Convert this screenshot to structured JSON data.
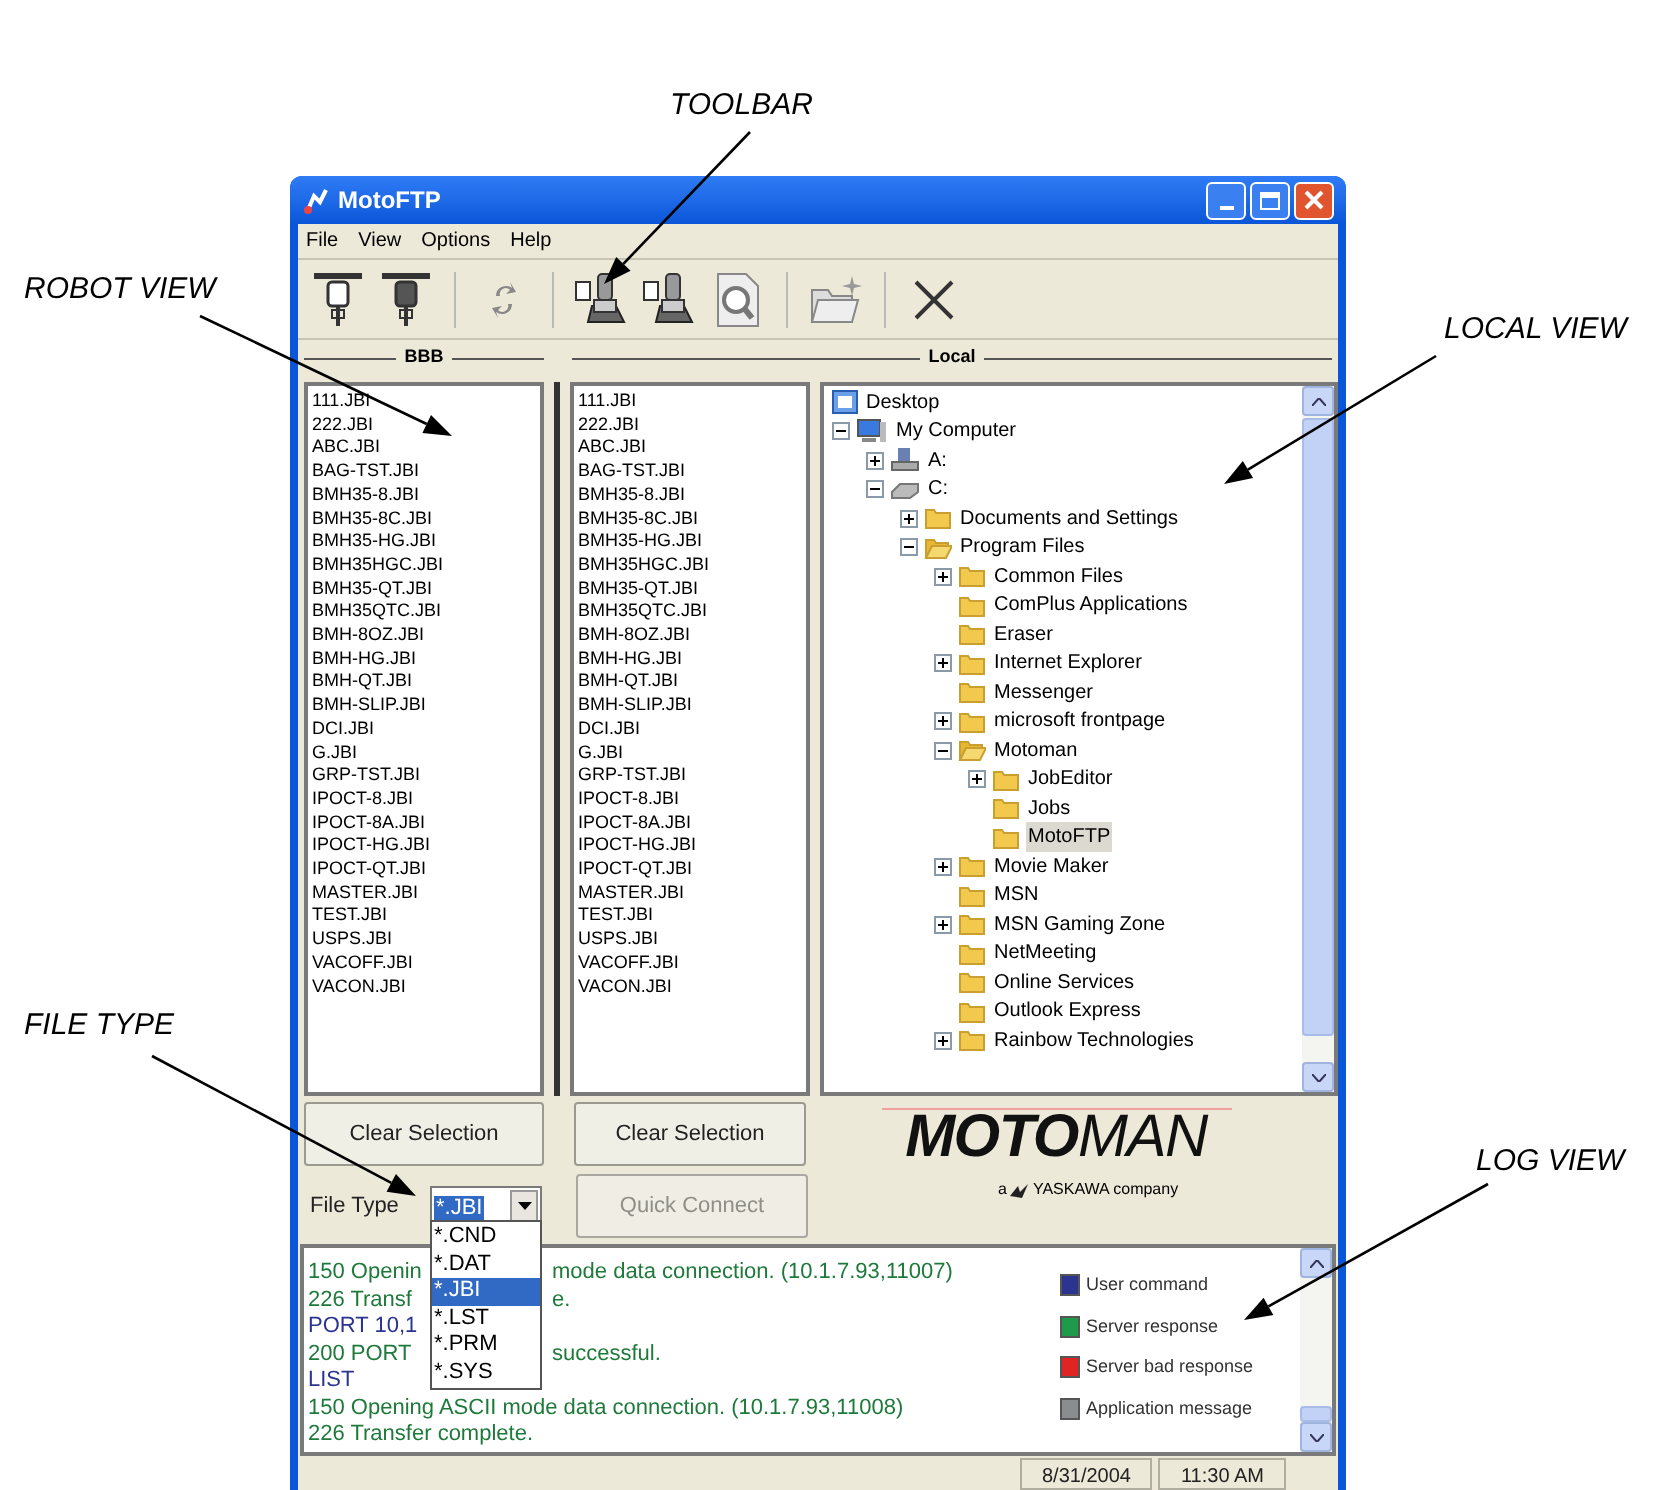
{
  "annotations": [
    "TOOLBAR",
    "ROBOT VIEW",
    "LOCAL VIEW",
    "FILE TYPE",
    "LOG VIEW"
  ],
  "window": {
    "title": "MotoFTP"
  },
  "menu": [
    "File",
    "View",
    "Options",
    "Help"
  ],
  "panes": {
    "robot_header": "BBB",
    "local_header": "Local"
  },
  "robot_files": [
    "111.JBI",
    "222.JBI",
    "ABC.JBI",
    "BAG-TST.JBI",
    "BMH35-8.JBI",
    "BMH35-8C.JBI",
    "BMH35-HG.JBI",
    "BMH35HGC.JBI",
    "BMH35-QT.JBI",
    "BMH35QTC.JBI",
    "BMH-8OZ.JBI",
    "BMH-HG.JBI",
    "BMH-QT.JBI",
    "BMH-SLIP.JBI",
    "DCI.JBI",
    "G.JBI",
    "GRP-TST.JBI",
    "IPOCT-8.JBI",
    "IPOCT-8A.JBI",
    "IPOCT-HG.JBI",
    "IPOCT-QT.JBI",
    "MASTER.JBI",
    "TEST.JBI",
    "USPS.JBI",
    "VACOFF.JBI",
    "VACON.JBI"
  ],
  "local_files": [
    "111.JBI",
    "222.JBI",
    "ABC.JBI",
    "BAG-TST.JBI",
    "BMH35-8.JBI",
    "BMH35-8C.JBI",
    "BMH35-HG.JBI",
    "BMH35HGC.JBI",
    "BMH35-QT.JBI",
    "BMH35QTC.JBI",
    "BMH-8OZ.JBI",
    "BMH-HG.JBI",
    "BMH-QT.JBI",
    "BMH-SLIP.JBI",
    "DCI.JBI",
    "G.JBI",
    "GRP-TST.JBI",
    "IPOCT-8.JBI",
    "IPOCT-8A.JBI",
    "IPOCT-HG.JBI",
    "IPOCT-QT.JBI",
    "MASTER.JBI",
    "TEST.JBI",
    "USPS.JBI",
    "VACOFF.JBI",
    "VACON.JBI"
  ],
  "tree": [
    {
      "label": "Desktop",
      "kind": "desktop",
      "selected": false,
      "children": [
        {
          "label": "My Computer",
          "kind": "computer",
          "expandable": true,
          "expanded": true,
          "selected": false,
          "children": [
            {
              "label": "A:",
              "kind": "floppy",
              "expandable": true,
              "expanded": false,
              "selected": false
            },
            {
              "label": "C:",
              "kind": "drive",
              "expandable": true,
              "expanded": true,
              "selected": false,
              "children": [
                {
                  "label": "Documents and Settings",
                  "kind": "folder",
                  "expandable": true,
                  "expanded": false,
                  "selected": false
                },
                {
                  "label": "Program Files",
                  "kind": "folder",
                  "expandable": true,
                  "expanded": true,
                  "selected": false,
                  "children": [
                    {
                      "label": "Common Files",
                      "kind": "folder",
                      "expandable": true,
                      "expanded": false,
                      "selected": false
                    },
                    {
                      "label": "ComPlus Applications",
                      "kind": "folder",
                      "expandable": false,
                      "expanded": false,
                      "selected": false
                    },
                    {
                      "label": "Eraser",
                      "kind": "folder",
                      "expandable": false,
                      "expanded": false,
                      "selected": false
                    },
                    {
                      "label": "Internet Explorer",
                      "kind": "folder",
                      "expandable": true,
                      "expanded": false,
                      "selected": false
                    },
                    {
                      "label": "Messenger",
                      "kind": "folder",
                      "expandable": false,
                      "expanded": false,
                      "selected": false
                    },
                    {
                      "label": "microsoft frontpage",
                      "kind": "folder",
                      "expandable": true,
                      "expanded": false,
                      "selected": false
                    },
                    {
                      "label": "Motoman",
                      "kind": "folder",
                      "expandable": true,
                      "expanded": true,
                      "selected": false,
                      "children": [
                        {
                          "label": "JobEditor",
                          "kind": "folder",
                          "expandable": true,
                          "expanded": false,
                          "selected": false
                        },
                        {
                          "label": "Jobs",
                          "kind": "folder",
                          "expandable": false,
                          "expanded": false,
                          "selected": false
                        },
                        {
                          "label": "MotoFTP",
                          "kind": "folder",
                          "expandable": false,
                          "expanded": false,
                          "selected": true
                        }
                      ]
                    },
                    {
                      "label": "Movie Maker",
                      "kind": "folder",
                      "expandable": true,
                      "expanded": false,
                      "selected": false
                    },
                    {
                      "label": "MSN",
                      "kind": "folder",
                      "expandable": false,
                      "expanded": false,
                      "selected": false
                    },
                    {
                      "label": "MSN Gaming Zone",
                      "kind": "folder",
                      "expandable": true,
                      "expanded": false,
                      "selected": false
                    },
                    {
                      "label": "NetMeeting",
                      "kind": "folder",
                      "expandable": false,
                      "expanded": false,
                      "selected": false
                    },
                    {
                      "label": "Online Services",
                      "kind": "folder",
                      "expandable": false,
                      "expanded": false,
                      "selected": false
                    },
                    {
                      "label": "Outlook Express",
                      "kind": "folder",
                      "expandable": false,
                      "expanded": false,
                      "selected": false
                    },
                    {
                      "label": "Rainbow Technologies",
                      "kind": "folder",
                      "expandable": true,
                      "expanded": false,
                      "selected": false
                    }
                  ]
                }
              ]
            }
          ]
        }
      ]
    }
  ],
  "buttons": {
    "clear_robot": "Clear Selection",
    "clear_local": "Clear Selection",
    "quick_connect": {
      "label": "Quick Connect",
      "disabled": true
    }
  },
  "logo": {
    "bold": "MOTO",
    "light": "MAN",
    "tagline_prefix": "a",
    "tagline": "YASKAWA company"
  },
  "file_type": {
    "label": "File Type",
    "value": "*.JBI",
    "options": [
      {
        "label": "*.CND",
        "selected": false
      },
      {
        "label": "*.DAT",
        "selected": false
      },
      {
        "label": "*.JBI",
        "selected": true
      },
      {
        "label": "*.LST",
        "selected": false
      },
      {
        "label": "*.PRM",
        "selected": false
      },
      {
        "label": "*.SYS",
        "selected": false
      }
    ]
  },
  "log": [
    {
      "text": "150 Openin",
      "rest": "mode data connection. (10.1.7.93,11007)",
      "color": "#1e7a3a"
    },
    {
      "text": "226 Transf",
      "rest": "e.",
      "color": "#1e7a3a"
    },
    {
      "text": "PORT 10,1",
      "color": "#2b3590"
    },
    {
      "text": "200 PORT",
      "rest": "successful.",
      "color": "#1e7a3a"
    },
    {
      "text": "LIST",
      "color": "#2b3590"
    },
    {
      "text": "150 Opening ASCII mode data connection. (10.1.7.93,11008)",
      "color": "#1e7a3a"
    },
    {
      "text": "226 Transfer complete.",
      "color": "#1e7a3a"
    }
  ],
  "legend": [
    {
      "label": "User command",
      "color": "#2b3590"
    },
    {
      "label": "Server response",
      "color": "#1e9a4a"
    },
    {
      "label": "Server bad response",
      "color": "#e02424"
    },
    {
      "label": "Application message",
      "color": "#8a8c90"
    }
  ],
  "status_bar": [
    "8/31/2004",
    "11:30 AM"
  ]
}
